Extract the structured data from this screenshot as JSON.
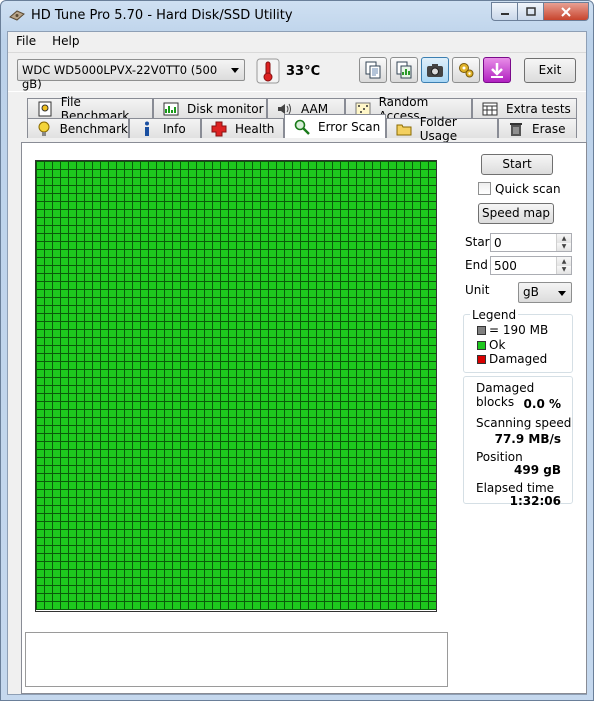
{
  "window": {
    "title": "HD Tune Pro 5.70 - Hard Disk/SSD Utility"
  },
  "menu": {
    "file": "File",
    "help": "Help"
  },
  "toolbar": {
    "drive": "WDC WD5000LPVX-22V0TT0 (500 gB)",
    "temperature": "33",
    "temperature_unit": "°C",
    "exit_label": "Exit"
  },
  "tabs_top": [
    "File Benchmark",
    "Disk monitor",
    "AAM",
    "Random Access",
    "Extra tests"
  ],
  "tabs_bottom": [
    "Benchmark",
    "Info",
    "Health",
    "Error Scan",
    "Folder Usage",
    "Erase"
  ],
  "selected_tab": "Error Scan",
  "scan": {
    "start_button": "Start",
    "quick_scan_label": "Quick scan",
    "quick_scan_checked": false,
    "speed_map_button": "Speed map",
    "start_label": "Start",
    "start_value": "0",
    "end_label": "End",
    "end_value": "500",
    "unit_label": "Unit",
    "unit_value": "gB",
    "grid_status": "ok",
    "grid_color": "#1ec81e"
  },
  "legend": {
    "title": "Legend",
    "items": [
      {
        "label": "= 190 MB",
        "color": "#808080"
      },
      {
        "label": "Ok",
        "color": "#1ec81e"
      },
      {
        "label": "Damaged",
        "color": "#d80000"
      }
    ]
  },
  "stats": {
    "damaged_blocks_label": "Damaged blocks",
    "damaged_blocks_value": "0.0 %",
    "scanning_speed_label": "Scanning speed",
    "scanning_speed_value": "77.9 MB/s",
    "position_label": "Position",
    "position_value": "499 gB",
    "elapsed_label": "Elapsed time",
    "elapsed_value": "1:32:06"
  }
}
